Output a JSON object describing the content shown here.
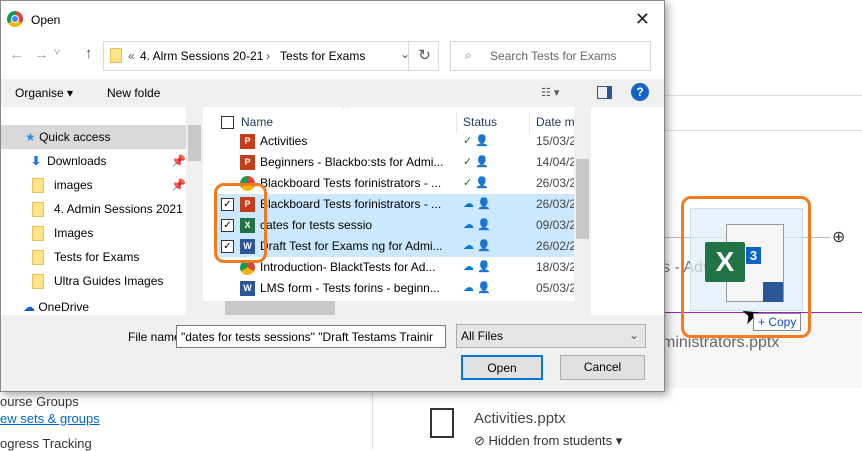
{
  "dialog": {
    "title": "Open",
    "close": "✕",
    "nav_buttons": {
      "back": "←",
      "forward": "→",
      "recent": "˅",
      "up": "↑"
    },
    "breadcrumb": {
      "prefix": "«",
      "parent": "4. Alrm Sessions 20-21",
      "sep": "›",
      "current": "Tests for Exams",
      "dropdown": "⌄",
      "refresh": "↻"
    },
    "search_placeholder": "Search Tests for Exams",
    "toolbar": {
      "organise": "Organise ▾",
      "new_folder": "New folde",
      "view": "▾",
      "help": "?"
    },
    "nav_pane": [
      {
        "label": "Quick access",
        "icon": "star-icon"
      },
      {
        "label": "Downloads",
        "icon": "download-icon",
        "pinned": true
      },
      {
        "label": "images",
        "icon": "folder-icon",
        "pinned": true
      },
      {
        "label": "4. Admin Sessions 2021",
        "icon": "folder-icon"
      },
      {
        "label": "Images",
        "icon": "folder-icon"
      },
      {
        "label": "Tests for Exams",
        "icon": "folder-icon"
      },
      {
        "label": "Ultra Guides Images",
        "icon": "folder-icon"
      },
      {
        "label": "OneDrive",
        "icon": "cloud-icon"
      }
    ],
    "columns": {
      "name": "Name",
      "status": "Status",
      "date": "Date m"
    },
    "files": [
      {
        "name": "Activities",
        "type": "pptx",
        "status": "synced",
        "date": "15/03/2",
        "selected": false
      },
      {
        "name": "Beginners - Blackbo:sts for Admi...",
        "type": "pptx",
        "status": "synced",
        "date": "14/04/2",
        "selected": false
      },
      {
        "name": "Blackboard Tests forinistrators - ...",
        "type": "chrome",
        "status": "synced",
        "date": "26/03/2",
        "selected": false
      },
      {
        "name": "Blackboard Tests forinistrators - ...",
        "type": "pptx",
        "status": "cloud",
        "date": "26/03/2",
        "selected": true
      },
      {
        "name": "cates for tests sessio",
        "type": "xlsx",
        "status": "cloud",
        "date": "09/03/2",
        "selected": true
      },
      {
        "name": "Draft Test for Exams ng for Admi...",
        "type": "docx",
        "status": "cloud",
        "date": "26/02/2",
        "selected": true
      },
      {
        "name": "Introduction- BlacktTests for Ad...",
        "type": "chrome",
        "status": "cloud",
        "date": "18/03/2",
        "selected": false
      },
      {
        "name": "LMS form - Tests forins - beginn...",
        "type": "docx",
        "status": "cloud",
        "date": "05/03/2",
        "selected": false
      }
    ],
    "file_name_label": "File name",
    "file_name_value": "\"dates for tests sessions\" \"Draft Testams Trainir",
    "file_type": "All Files",
    "open": "Open",
    "cancel": "Cancel"
  },
  "background": {
    "partial_title": "s - Adva",
    "file_title": "ministrators.pptx",
    "left": {
      "course_groups": "ourse Groups",
      "view_sets": "ew sets & groups",
      "progress": "ogress Tracking"
    },
    "item": {
      "name": "Activities.pptx",
      "visibility": "Hidden from students ▾"
    },
    "add": "⊕"
  },
  "drag": {
    "count": "3",
    "copy": "+ Copy"
  },
  "colors": {
    "accent": "#0078d7",
    "highlight": "#f47a20",
    "selection": "#cce8ff",
    "excel": "#217346",
    "ppt": "#c43e1c",
    "word": "#2b579a"
  }
}
